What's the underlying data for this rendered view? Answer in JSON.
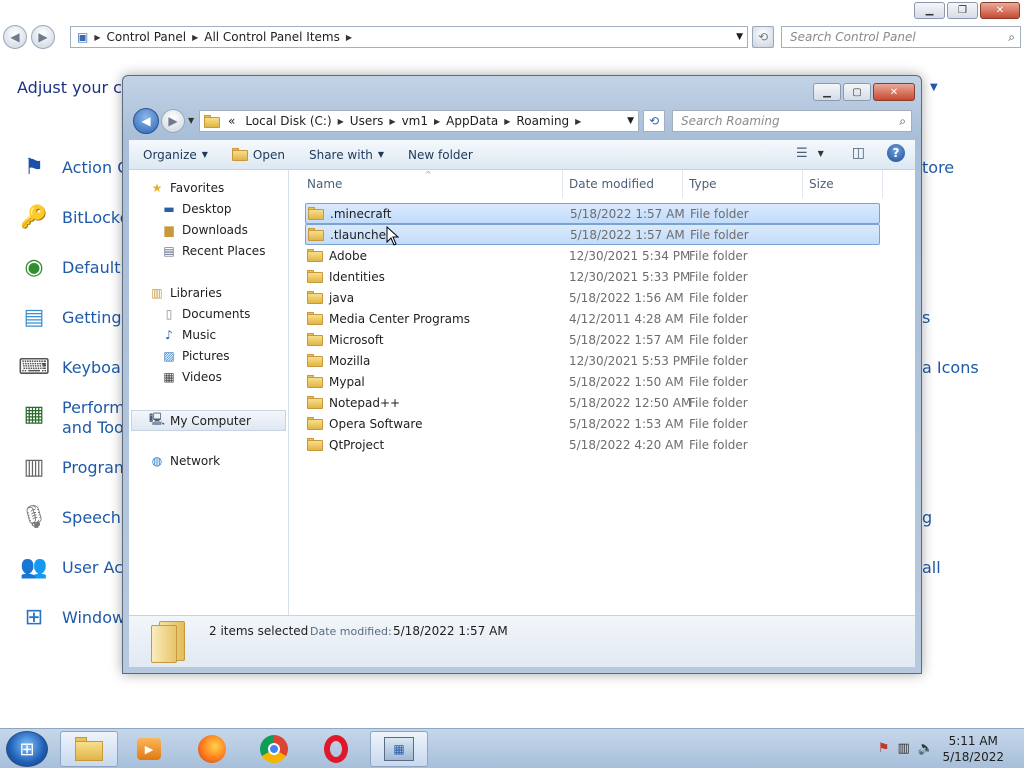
{
  "control_panel": {
    "breadcrumb": [
      "Control Panel",
      "All Control Panel Items"
    ],
    "search_placeholder": "Search Control Panel",
    "heading": "Adjust your co",
    "items_left": [
      {
        "label": "Action C",
        "icon": "flag-icon"
      },
      {
        "label": "BitLocker",
        "icon": "bitlocker-key-icon"
      },
      {
        "label": "Default P",
        "icon": "default-programs-icon"
      },
      {
        "label": "Getting S",
        "icon": "getting-started-icon"
      },
      {
        "label": "Keyboard",
        "icon": "keyboard-icon"
      },
      {
        "label": "Performa",
        "label2": "and Tool",
        "icon": "performance-icon"
      },
      {
        "label": "Program",
        "icon": "programs-icon"
      },
      {
        "label": "Speech R",
        "icon": "microphone-icon"
      },
      {
        "label": "User Acc",
        "icon": "users-icon"
      },
      {
        "label": "Windows",
        "icon": "windows-update-icon"
      }
    ],
    "items_right": [
      {
        "label": "tore"
      },
      {
        "label": "s"
      },
      {
        "label": "a Icons"
      },
      {
        "label": "g"
      },
      {
        "label": "all"
      }
    ]
  },
  "explorer": {
    "address": [
      "Local Disk (C:)",
      "Users",
      "vm1",
      "AppData",
      "Roaming"
    ],
    "address_prefix": "«",
    "search_placeholder": "Search Roaming",
    "toolbar": {
      "organize": "Organize",
      "open": "Open",
      "share_with": "Share with",
      "new_folder": "New folder"
    },
    "nav_pane": {
      "favorites": "Favorites",
      "favorites_items": [
        "Desktop",
        "Downloads",
        "Recent Places"
      ],
      "libraries": "Libraries",
      "libraries_items": [
        "Documents",
        "Music",
        "Pictures",
        "Videos"
      ],
      "computer": "My Computer",
      "network": "Network"
    },
    "columns": {
      "name": "Name",
      "date": "Date modified",
      "type": "Type",
      "size": "Size"
    },
    "files": [
      {
        "name": ".minecraft",
        "date": "5/18/2022 1:57 AM",
        "type": "File folder",
        "selected": true
      },
      {
        "name": ".tlauncher",
        "date": "5/18/2022 1:57 AM",
        "type": "File folder",
        "selected": true
      },
      {
        "name": "Adobe",
        "date": "12/30/2021 5:34 PM",
        "type": "File folder",
        "selected": false
      },
      {
        "name": "Identities",
        "date": "12/30/2021 5:33 PM",
        "type": "File folder",
        "selected": false
      },
      {
        "name": "java",
        "date": "5/18/2022 1:56 AM",
        "type": "File folder",
        "selected": false
      },
      {
        "name": "Media Center Programs",
        "date": "4/12/2011 4:28 AM",
        "type": "File folder",
        "selected": false
      },
      {
        "name": "Microsoft",
        "date": "5/18/2022 1:57 AM",
        "type": "File folder",
        "selected": false
      },
      {
        "name": "Mozilla",
        "date": "12/30/2021 5:53 PM",
        "type": "File folder",
        "selected": false
      },
      {
        "name": "Mypal",
        "date": "5/18/2022 1:50 AM",
        "type": "File folder",
        "selected": false
      },
      {
        "name": "Notepad++",
        "date": "5/18/2022 12:50 AM",
        "type": "File folder",
        "selected": false
      },
      {
        "name": "Opera Software",
        "date": "5/18/2022 1:53 AM",
        "type": "File folder",
        "selected": false
      },
      {
        "name": "QtProject",
        "date": "5/18/2022 4:20 AM",
        "type": "File folder",
        "selected": false
      }
    ],
    "details": {
      "selection": "2 items selected",
      "date_label": "Date modified:",
      "date_value": "5/18/2022 1:57 AM"
    }
  },
  "taskbar": {
    "time": "5:11 AM",
    "date": "5/18/2022",
    "apps": [
      "explorer-icon",
      "media-player-icon",
      "firefox-icon",
      "chrome-icon",
      "opera-icon",
      "control-panel-icon"
    ]
  },
  "colors": {
    "link": "#1e5aa8",
    "selection": "#c1dcfc",
    "selection_border": "#7da2ce"
  }
}
